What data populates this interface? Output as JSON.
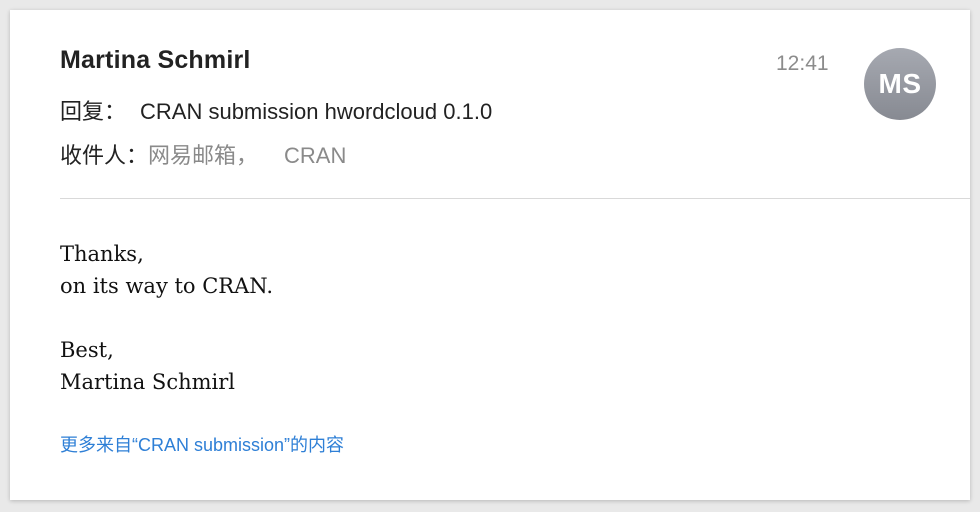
{
  "email": {
    "sender_name": "Martina Schmirl",
    "time": "12:41",
    "avatar_initials": "MS",
    "subject_prefix": "回复：",
    "subject": "CRAN submission hwordcloud 0.1.0",
    "recipients_label": "收件人：",
    "recipients": [
      "网易邮箱，",
      "CRAN"
    ],
    "body_lines": [
      "Thanks,",
      "on its way to CRAN.",
      "",
      "Best,",
      "Martina Schmirl"
    ],
    "more_link": "更多来自“CRAN submission”的内容"
  },
  "colors": {
    "link": "#2e7fd6",
    "avatar_bg": "#8f9299",
    "secondary_text": "#8a8a8a"
  }
}
